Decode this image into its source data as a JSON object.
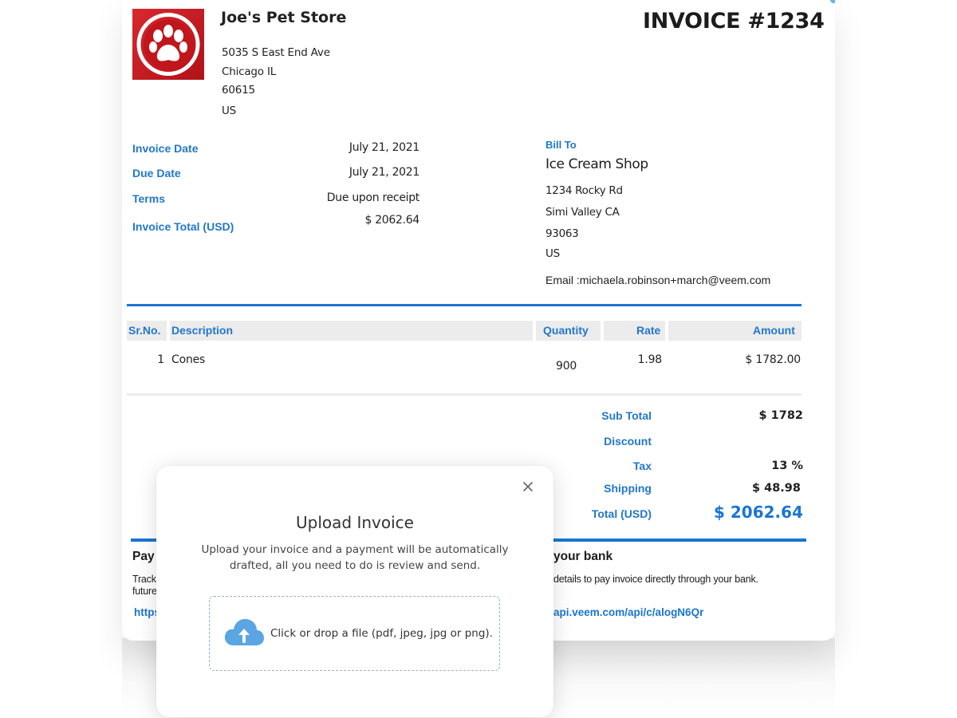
{
  "store": {
    "name": "Joe's Pet Store",
    "address": [
      "5035 S East End Ave",
      "Chicago  IL",
      "60615",
      "US"
    ]
  },
  "invoice": {
    "title": "INVOICE #1234",
    "meta": [
      {
        "label": "Invoice Date",
        "value": "July 21, 2021"
      },
      {
        "label": "Due Date",
        "value": "July 21, 2021"
      },
      {
        "label": "Terms",
        "value": "Due upon receipt"
      },
      {
        "label": "Invoice Total (USD)",
        "value": "$ 2062.64"
      }
    ]
  },
  "bill_to": {
    "label": "Bill To",
    "name": "Ice Cream Shop",
    "address": [
      "1234 Rocky Rd",
      "Simi Valley  CA",
      "93063",
      "US"
    ],
    "email": "Email :michaela.robinson+march@veem.com"
  },
  "table": {
    "headers": {
      "srno": "Sr.No.",
      "description": "Description",
      "quantity": "Quantity",
      "rate": "Rate",
      "amount": "Amount"
    },
    "rows": [
      {
        "srno": "1",
        "description": "Cones",
        "quantity": "900",
        "rate": "1.98",
        "amount": "$ 1782.00"
      }
    ]
  },
  "totals": [
    {
      "label": "Sub Total",
      "value": "$ 1782"
    },
    {
      "label": "Discount",
      "value": ""
    },
    {
      "label": "Tax",
      "value": "13 %"
    },
    {
      "label": "Shipping",
      "value": "$ 48.98"
    },
    {
      "label": "Total (USD)",
      "value": "$ 2062.64"
    }
  ],
  "payment": {
    "left_title": "Pay",
    "left_desc_1": "Track",
    "left_desc_2": "future",
    "left_link": "https",
    "right_title": "your bank",
    "right_desc": "details to pay invoice directly through your bank.",
    "right_link": "api.veem.com/api/c/alogN6Qr"
  },
  "modal": {
    "title": "Upload Invoice",
    "desc_line1": "Upload your invoice and a payment will be automatically",
    "desc_line2": "drafted, all you need to do is review and send.",
    "drop_text": "Click or drop a file (pdf, jpeg, jpg or png)."
  },
  "colors": {
    "accent": "#1a75d2",
    "label_blue": "#2277cc",
    "logo_red": "#c8161d"
  },
  "icons": [
    "paw-logo-icon",
    "close-icon",
    "cloud-upload-icon"
  ]
}
